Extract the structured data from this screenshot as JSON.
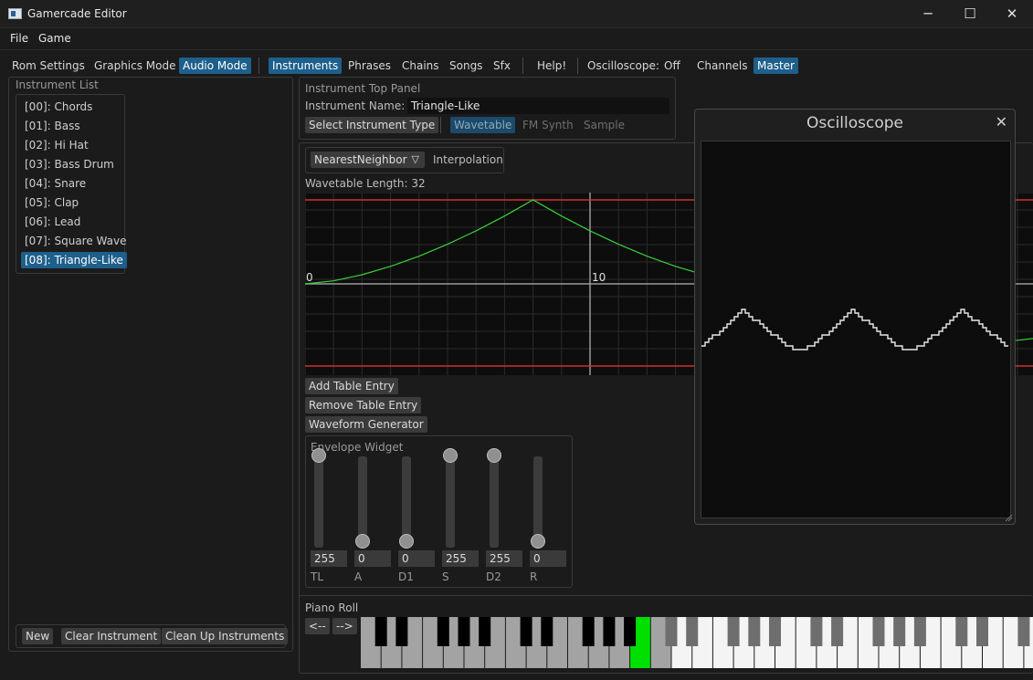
{
  "window": {
    "title": "Gamercade Editor",
    "minimize": "─",
    "maximize": "☐",
    "close": "✕"
  },
  "menubar": {
    "file": "File",
    "game": "Game"
  },
  "toolbar": {
    "rom_settings": "Rom Settings",
    "graphics_mode": "Graphics Mode",
    "audio_mode": "Audio Mode",
    "instruments": "Instruments",
    "phrases": "Phrases",
    "chains": "Chains",
    "songs": "Songs",
    "sfx": "Sfx",
    "help": "Help!",
    "oscilloscope_label": "Oscilloscope:",
    "osc_off": "Off",
    "osc_channels": "Channels",
    "osc_master": "Master"
  },
  "instrument_list": {
    "title": "Instrument List",
    "items": [
      "[00]: Chords",
      "[01]: Bass",
      "[02]: Hi Hat",
      "[03]: Bass Drum",
      "[04]: Snare",
      "[05]: Clap",
      "[06]: Lead",
      "[07]: Square Wave",
      "[08]: Triangle-Like"
    ],
    "selected_index": 8,
    "new_button": "New",
    "clear_button": "Clear Instrument",
    "cleanup_button": "Clean Up Instruments"
  },
  "top_panel": {
    "title": "Instrument Top Panel",
    "name_label": "Instrument Name:",
    "name_value": "Triangle-Like",
    "select_type_button": "Select Instrument Type",
    "type_wavetable": "Wavetable",
    "type_fm": "FM Synth",
    "type_sample": "Sample"
  },
  "wavetable": {
    "interpolation_value": "NearestNeighbor",
    "interpolation_label": "Interpolation",
    "length_label": "Wavetable Length: 32",
    "axis_zero": "0",
    "axis_ten": "10",
    "add_entry": "Add Table Entry",
    "remove_entry": "Remove Table Entry",
    "waveform_generator": "Waveform Generator"
  },
  "envelope": {
    "title": "Envelope Widget",
    "params": [
      {
        "label": "TL",
        "value": "255",
        "level": 1.0
      },
      {
        "label": "A",
        "value": "0",
        "level": 0.0
      },
      {
        "label": "D1",
        "value": "0",
        "level": 0.0
      },
      {
        "label": "S",
        "value": "255",
        "level": 1.0
      },
      {
        "label": "D2",
        "value": "255",
        "level": 1.0
      },
      {
        "label": "R",
        "value": "0",
        "level": 0.0
      }
    ]
  },
  "oscilloscope": {
    "title": "Oscilloscope",
    "close": "✕"
  },
  "piano": {
    "title": "Piano Roll",
    "prev": "<--",
    "next": "-->"
  },
  "colors": {
    "accent": "#1e5f8b",
    "wave": "#39d139",
    "bounds": "#d23030",
    "key_active": "#00e000"
  }
}
